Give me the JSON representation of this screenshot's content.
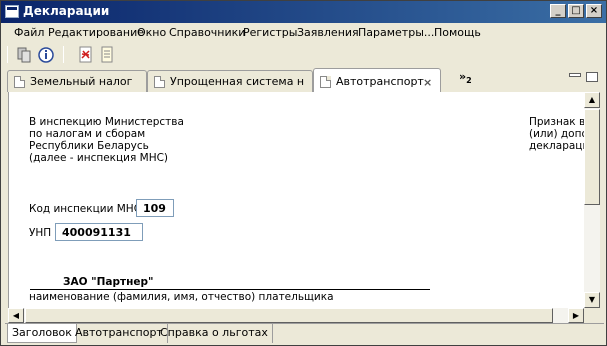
{
  "window": {
    "title": "Декларации",
    "controls": {
      "minimize": "_",
      "maximize": "□",
      "close": "×"
    }
  },
  "menu": [
    "Файл",
    "Редактирование",
    "Окно",
    "Справочники",
    "Регистры",
    "Заявления",
    "Параметры...",
    "Помощь"
  ],
  "toolbar": {
    "icons": [
      "copy-icon",
      "info-icon",
      "pdf-icon",
      "document-icon"
    ]
  },
  "tabs": [
    {
      "label": "Земельный налог",
      "active": false
    },
    {
      "label": "Упрощенная система н",
      "active": false
    },
    {
      "label": "Автотранспорт",
      "active": true,
      "close": "×"
    }
  ],
  "tabs_overflow": {
    "label": "»",
    "count": "2"
  },
  "form": {
    "address_lines": [
      "В инспекцию Министерства",
      "по налогам и сборам",
      "Республики Беларусь",
      "(далее - инспекция МНС)"
    ],
    "right_lines": [
      "Признак вн",
      "(или) допо",
      "деклараци"
    ],
    "inspection_code_label": "Код инспекции МНС",
    "inspection_code_value": "109",
    "unp_label": "УНП",
    "unp_value": "400091131",
    "payer_name": "ЗАО \"Партнер\"",
    "payer_caption": "наименование (фамилия, имя, отчество) плательщика"
  },
  "bottom_tabs": [
    {
      "label": "Заголовок",
      "active": true
    },
    {
      "label": "Автотранспорт",
      "active": false
    },
    {
      "label": "Справка о льготах",
      "active": false
    }
  ],
  "colors": {
    "titlebar_start": "#0a246a",
    "titlebar_end": "#3a6ea5",
    "chrome": "#ece9d8",
    "field_border": "#7f9db9"
  }
}
